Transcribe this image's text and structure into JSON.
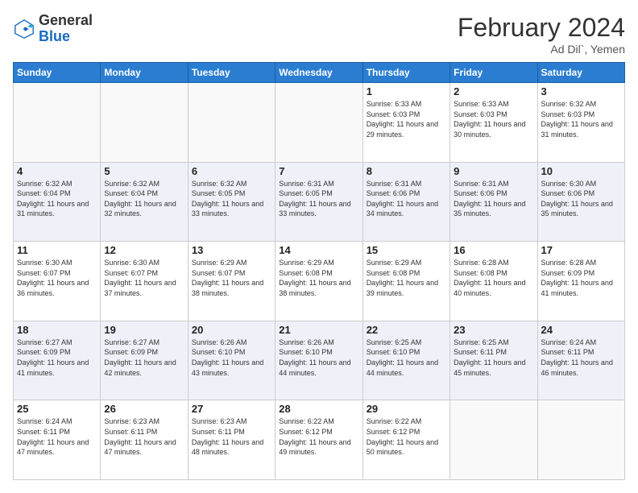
{
  "header": {
    "logo_general": "General",
    "logo_blue": "Blue",
    "month_title": "February 2024",
    "location": "Ad Dil`, Yemen"
  },
  "weekdays": [
    "Sunday",
    "Monday",
    "Tuesday",
    "Wednesday",
    "Thursday",
    "Friday",
    "Saturday"
  ],
  "weeks": [
    [
      {
        "day": "",
        "info": ""
      },
      {
        "day": "",
        "info": ""
      },
      {
        "day": "",
        "info": ""
      },
      {
        "day": "",
        "info": ""
      },
      {
        "day": "1",
        "info": "Sunrise: 6:33 AM\nSunset: 6:03 PM\nDaylight: 11 hours and 29 minutes."
      },
      {
        "day": "2",
        "info": "Sunrise: 6:33 AM\nSunset: 6:03 PM\nDaylight: 11 hours and 30 minutes."
      },
      {
        "day": "3",
        "info": "Sunrise: 6:32 AM\nSunset: 6:03 PM\nDaylight: 11 hours and 31 minutes."
      }
    ],
    [
      {
        "day": "4",
        "info": "Sunrise: 6:32 AM\nSunset: 6:04 PM\nDaylight: 11 hours and 31 minutes."
      },
      {
        "day": "5",
        "info": "Sunrise: 6:32 AM\nSunset: 6:04 PM\nDaylight: 11 hours and 32 minutes."
      },
      {
        "day": "6",
        "info": "Sunrise: 6:32 AM\nSunset: 6:05 PM\nDaylight: 11 hours and 33 minutes."
      },
      {
        "day": "7",
        "info": "Sunrise: 6:31 AM\nSunset: 6:05 PM\nDaylight: 11 hours and 33 minutes."
      },
      {
        "day": "8",
        "info": "Sunrise: 6:31 AM\nSunset: 6:06 PM\nDaylight: 11 hours and 34 minutes."
      },
      {
        "day": "9",
        "info": "Sunrise: 6:31 AM\nSunset: 6:06 PM\nDaylight: 11 hours and 35 minutes."
      },
      {
        "day": "10",
        "info": "Sunrise: 6:30 AM\nSunset: 6:06 PM\nDaylight: 11 hours and 35 minutes."
      }
    ],
    [
      {
        "day": "11",
        "info": "Sunrise: 6:30 AM\nSunset: 6:07 PM\nDaylight: 11 hours and 36 minutes."
      },
      {
        "day": "12",
        "info": "Sunrise: 6:30 AM\nSunset: 6:07 PM\nDaylight: 11 hours and 37 minutes."
      },
      {
        "day": "13",
        "info": "Sunrise: 6:29 AM\nSunset: 6:07 PM\nDaylight: 11 hours and 38 minutes."
      },
      {
        "day": "14",
        "info": "Sunrise: 6:29 AM\nSunset: 6:08 PM\nDaylight: 11 hours and 38 minutes."
      },
      {
        "day": "15",
        "info": "Sunrise: 6:29 AM\nSunset: 6:08 PM\nDaylight: 11 hours and 39 minutes."
      },
      {
        "day": "16",
        "info": "Sunrise: 6:28 AM\nSunset: 6:08 PM\nDaylight: 11 hours and 40 minutes."
      },
      {
        "day": "17",
        "info": "Sunrise: 6:28 AM\nSunset: 6:09 PM\nDaylight: 11 hours and 41 minutes."
      }
    ],
    [
      {
        "day": "18",
        "info": "Sunrise: 6:27 AM\nSunset: 6:09 PM\nDaylight: 11 hours and 41 minutes."
      },
      {
        "day": "19",
        "info": "Sunrise: 6:27 AM\nSunset: 6:09 PM\nDaylight: 11 hours and 42 minutes."
      },
      {
        "day": "20",
        "info": "Sunrise: 6:26 AM\nSunset: 6:10 PM\nDaylight: 11 hours and 43 minutes."
      },
      {
        "day": "21",
        "info": "Sunrise: 6:26 AM\nSunset: 6:10 PM\nDaylight: 11 hours and 44 minutes."
      },
      {
        "day": "22",
        "info": "Sunrise: 6:25 AM\nSunset: 6:10 PM\nDaylight: 11 hours and 44 minutes."
      },
      {
        "day": "23",
        "info": "Sunrise: 6:25 AM\nSunset: 6:11 PM\nDaylight: 11 hours and 45 minutes."
      },
      {
        "day": "24",
        "info": "Sunrise: 6:24 AM\nSunset: 6:11 PM\nDaylight: 11 hours and 46 minutes."
      }
    ],
    [
      {
        "day": "25",
        "info": "Sunrise: 6:24 AM\nSunset: 6:11 PM\nDaylight: 11 hours and 47 minutes."
      },
      {
        "day": "26",
        "info": "Sunrise: 6:23 AM\nSunset: 6:11 PM\nDaylight: 11 hours and 47 minutes."
      },
      {
        "day": "27",
        "info": "Sunrise: 6:23 AM\nSunset: 6:11 PM\nDaylight: 11 hours and 48 minutes."
      },
      {
        "day": "28",
        "info": "Sunrise: 6:22 AM\nSunset: 6:12 PM\nDaylight: 11 hours and 49 minutes."
      },
      {
        "day": "29",
        "info": "Sunrise: 6:22 AM\nSunset: 6:12 PM\nDaylight: 11 hours and 50 minutes."
      },
      {
        "day": "",
        "info": ""
      },
      {
        "day": "",
        "info": ""
      }
    ]
  ]
}
